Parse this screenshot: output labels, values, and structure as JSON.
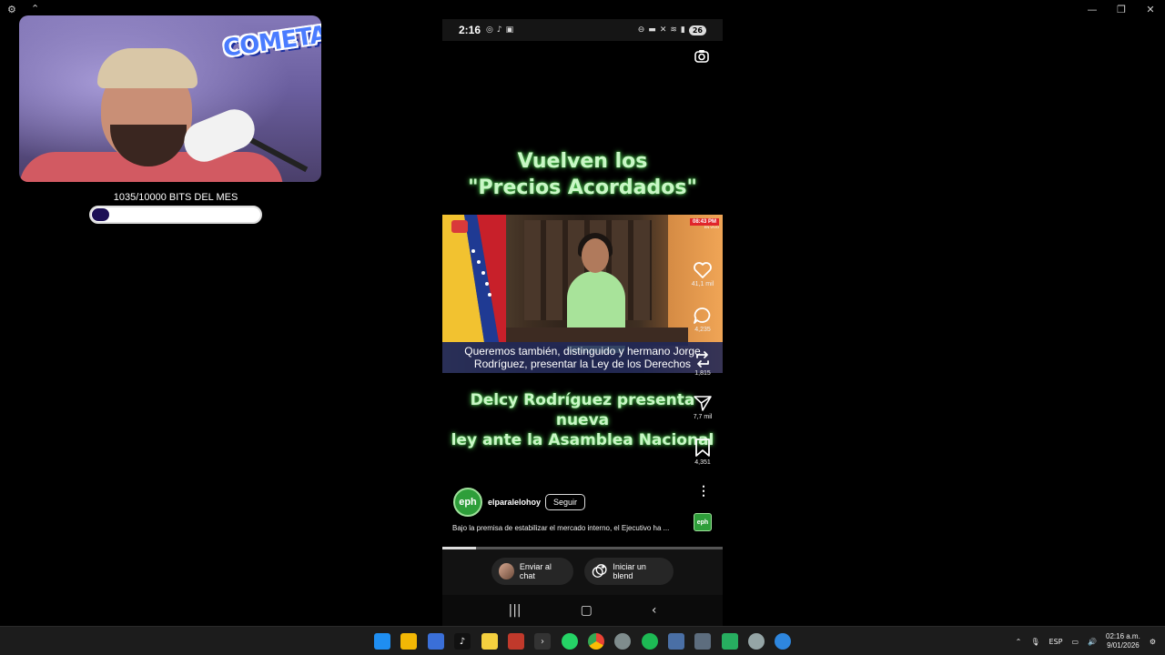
{
  "stream": {
    "logo_text": "COMETA",
    "bits_label": "1035/10000 BITS DEL MES",
    "bits_current": 1035,
    "bits_goal": 10000
  },
  "phone": {
    "status_time": "2:16",
    "battery": "26",
    "headline_top": [
      "Vuelven los",
      "\"Precios Acordados\""
    ],
    "video": {
      "badge": "08:43 PM",
      "badge_sub": "EN VIVO",
      "subtitle": [
        "Queremos también, distinguido y hermano Jorge",
        "Rodríguez, presentar la Ley de los Derechos"
      ]
    },
    "headline_bottom": [
      "Delcy Rodríguez presenta nueva",
      "ley ante la Asamblea Nacional"
    ],
    "rail": {
      "likes": "41,1 mil",
      "comments": "4,235",
      "reposts": "1,815",
      "shares": "7,7 mil",
      "saves": "4,351"
    },
    "profile_initials": "eph",
    "username": "elparalelohoy",
    "follow_label": "Seguir",
    "caption": "Bajo la premisa de estabilizar el mercado interno, el Ejecutivo ha ...",
    "audio_initials": "eph",
    "progress": 0.12,
    "actions": {
      "send_chat": "Enviar al chat",
      "start_blend": "Iniciar un blend"
    }
  },
  "taskbar": {
    "language": "ESP",
    "time": "02:16 a.m.",
    "date": "9/01/2026"
  }
}
